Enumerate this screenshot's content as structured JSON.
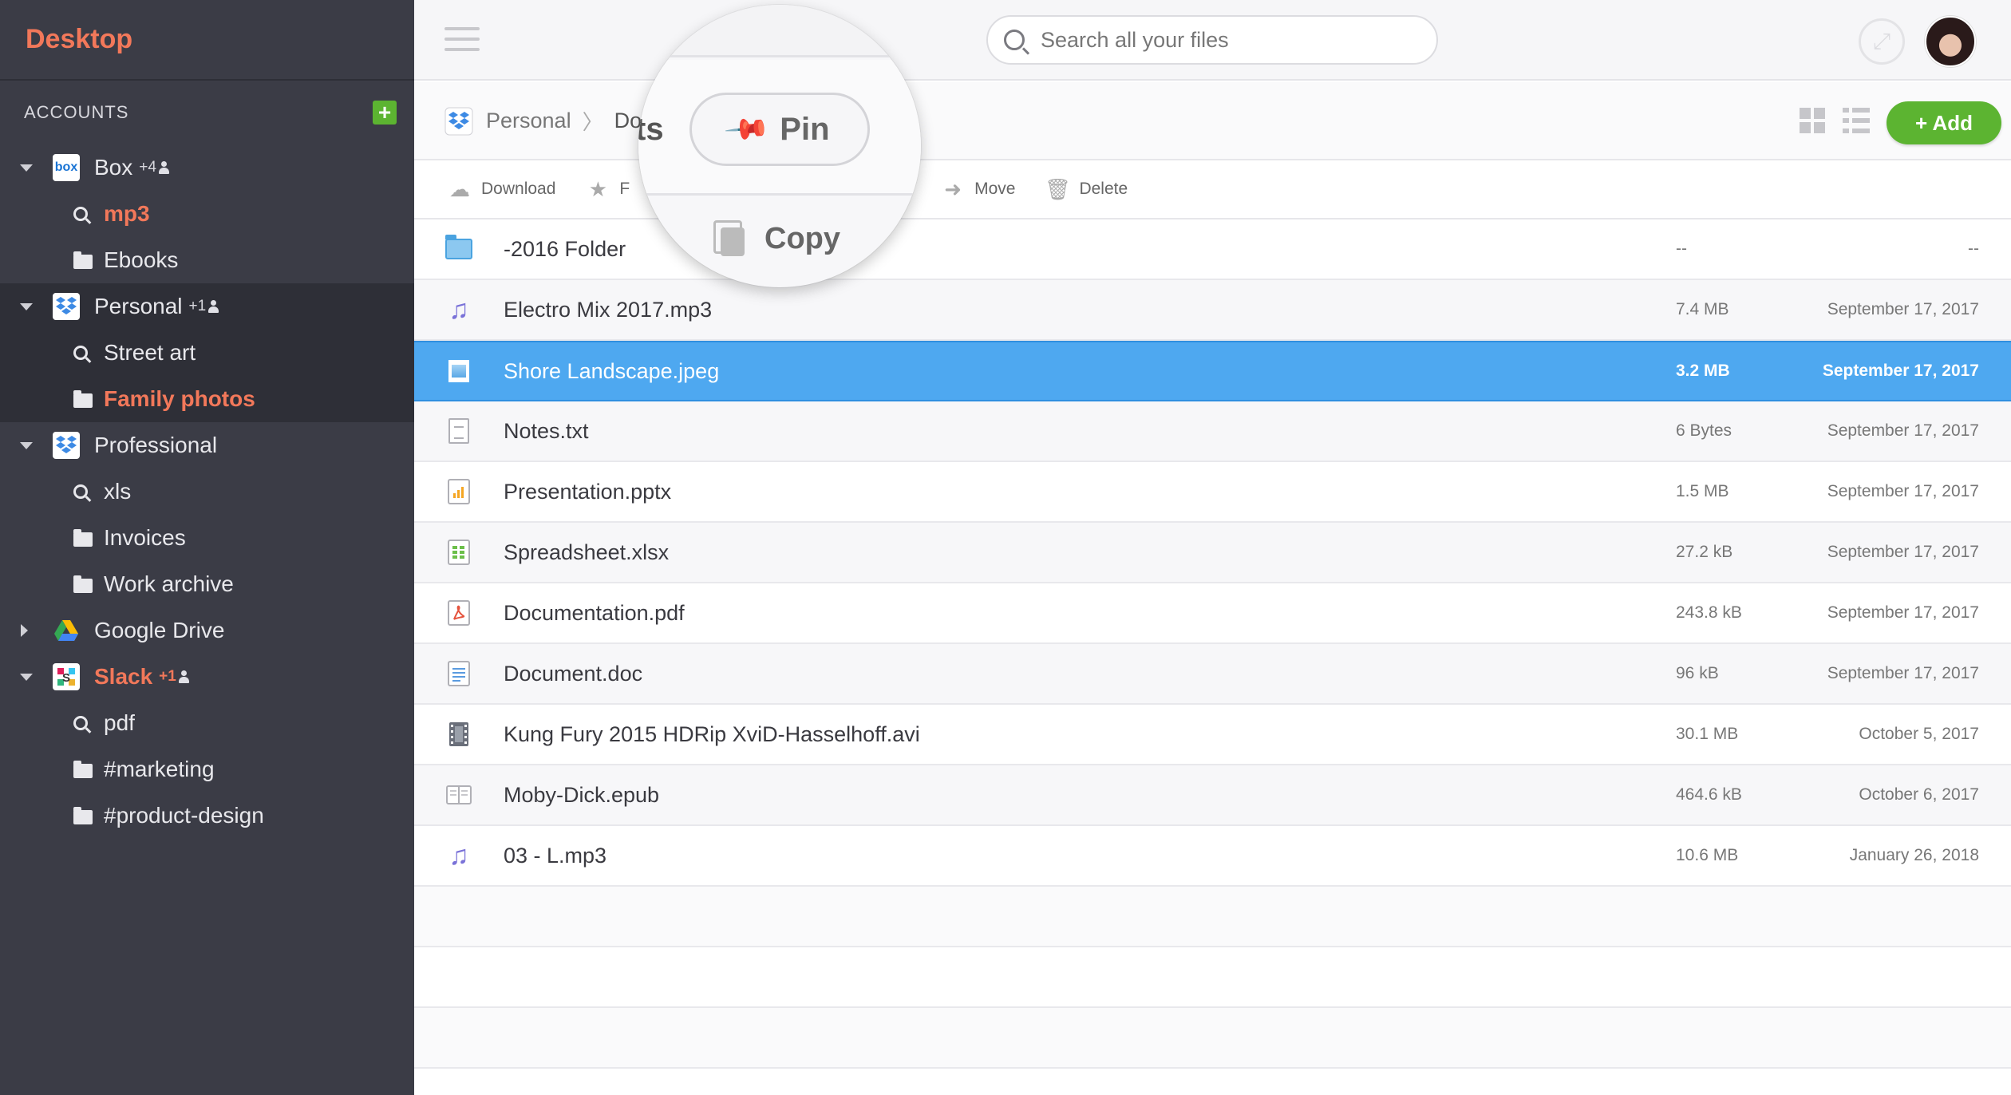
{
  "sidebar": {
    "brand": "Desktop",
    "accounts_title": "ACCOUNTS",
    "add_account_label": "+",
    "accounts": [
      {
        "name": "Box",
        "badge": "+4",
        "icon": "box-icon",
        "expanded": true,
        "items": [
          {
            "label": "mp3",
            "type": "search",
            "active": true
          },
          {
            "label": "Ebooks",
            "type": "folder"
          }
        ]
      },
      {
        "name": "Personal",
        "badge": "+1",
        "icon": "dropbox-icon",
        "expanded": true,
        "selected": true,
        "items": [
          {
            "label": "Street art",
            "type": "search"
          },
          {
            "label": "Family photos",
            "type": "folder",
            "active": true
          }
        ]
      },
      {
        "name": "Professional",
        "badge": "",
        "icon": "dropbox-icon",
        "expanded": true,
        "items": [
          {
            "label": "xls",
            "type": "search"
          },
          {
            "label": "Invoices",
            "type": "folder"
          },
          {
            "label": "Work archive",
            "type": "folder"
          }
        ]
      },
      {
        "name": "Google Drive",
        "badge": "",
        "icon": "google-drive-icon",
        "expanded": false,
        "items": []
      },
      {
        "name": "Slack",
        "badge": "+1",
        "icon": "slack-icon",
        "expanded": true,
        "active": true,
        "items": [
          {
            "label": "pdf",
            "type": "search"
          },
          {
            "label": "#marketing",
            "type": "folder"
          },
          {
            "label": "#product-design",
            "type": "folder"
          }
        ]
      }
    ]
  },
  "topbar": {
    "search_placeholder": "Search all your files"
  },
  "breadcrumb": {
    "root": "Personal",
    "current": "Doc"
  },
  "toolbar": {
    "add_label": "+  Add",
    "actions": [
      {
        "label": "Download",
        "icon": "cloud-download-icon"
      },
      {
        "label": "F",
        "icon": "star-icon"
      },
      {
        "label": "opy",
        "icon": ""
      },
      {
        "label": "Move",
        "icon": "move-arrow-icon"
      },
      {
        "label": "Delete",
        "icon": "trash-icon"
      }
    ]
  },
  "magnifier": {
    "partial_text": "ts",
    "pin_label": "Pin",
    "copy_label": "Copy"
  },
  "files": [
    {
      "name": "-2016 Folder",
      "size": "--",
      "date": "--",
      "icon": "folder-icon"
    },
    {
      "name": "Electro Mix 2017.mp3",
      "size": "7.4 MB",
      "date": "September 17, 2017",
      "icon": "music-icon"
    },
    {
      "name": "Shore Landscape.jpeg",
      "size": "3.2 MB",
      "date": "September 17, 2017",
      "icon": "image-icon",
      "selected": true
    },
    {
      "name": "Notes.txt",
      "size": "6 Bytes",
      "date": "September 17, 2017",
      "icon": "text-file-icon"
    },
    {
      "name": "Presentation.pptx",
      "size": "1.5 MB",
      "date": "September 17, 2017",
      "icon": "presentation-icon"
    },
    {
      "name": "Spreadsheet.xlsx",
      "size": "27.2 kB",
      "date": "September 17, 2017",
      "icon": "spreadsheet-icon"
    },
    {
      "name": "Documentation.pdf",
      "size": "243.8 kB",
      "date": "September 17, 2017",
      "icon": "pdf-icon"
    },
    {
      "name": "Document.doc",
      "size": "96 kB",
      "date": "September 17, 2017",
      "icon": "document-icon"
    },
    {
      "name": "Kung Fury 2015 HDRip XviD-Hasselhoff.avi",
      "size": "30.1 MB",
      "date": "October 5, 2017",
      "icon": "video-icon"
    },
    {
      "name": "Moby-Dick.epub",
      "size": "464.6 kB",
      "date": "October 6, 2017",
      "icon": "ebook-icon"
    },
    {
      "name": "03 - L.mp3",
      "size": "10.6 MB",
      "date": "January 26, 2018",
      "icon": "music-icon"
    }
  ],
  "colors": {
    "accent": "#f2785a",
    "sidebar_bg": "#3b3c46",
    "selection": "#4ea8f0",
    "add_button": "#5cb431"
  }
}
